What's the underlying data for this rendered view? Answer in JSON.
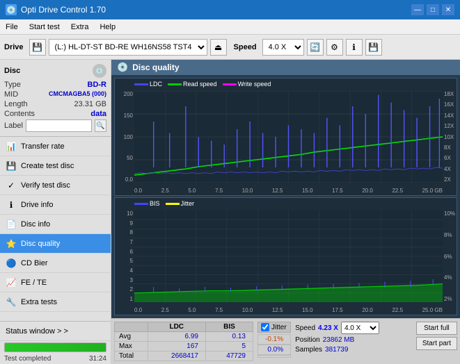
{
  "app": {
    "title": "Opti Drive Control 1.70",
    "icon": "💿"
  },
  "titlebar": {
    "title": "Opti Drive Control 1.70",
    "minimize": "—",
    "maximize": "□",
    "close": "✕"
  },
  "menubar": {
    "items": [
      "File",
      "Start test",
      "Extra",
      "Help"
    ]
  },
  "toolbar": {
    "drive_label": "Drive",
    "drive_value": "(L:) HL-DT-ST BD-RE WH16NS58 TST4",
    "speed_label": "Speed",
    "speed_value": "4.0 X"
  },
  "disc": {
    "section_label": "Disc",
    "type_key": "Type",
    "type_val": "BD-R",
    "mid_key": "MID",
    "mid_val": "CMCMAGBA5 (000)",
    "length_key": "Length",
    "length_val": "23.31 GB",
    "contents_key": "Contents",
    "contents_val": "data",
    "label_key": "Label",
    "label_placeholder": ""
  },
  "nav": {
    "items": [
      {
        "id": "transfer-rate",
        "label": "Transfer rate",
        "icon": "📊"
      },
      {
        "id": "create-test-disc",
        "label": "Create test disc",
        "icon": "💾"
      },
      {
        "id": "verify-test-disc",
        "label": "Verify test disc",
        "icon": "✓"
      },
      {
        "id": "drive-info",
        "label": "Drive info",
        "icon": "ℹ"
      },
      {
        "id": "disc-info",
        "label": "Disc info",
        "icon": "📄"
      },
      {
        "id": "disc-quality",
        "label": "Disc quality",
        "icon": "⭐",
        "active": true
      },
      {
        "id": "cd-bier",
        "label": "CD Bier",
        "icon": "🔵"
      },
      {
        "id": "fe-te",
        "label": "FE / TE",
        "icon": "📈"
      },
      {
        "id": "extra-tests",
        "label": "Extra tests",
        "icon": "🔧"
      }
    ]
  },
  "status_window": {
    "label": "Status window > >",
    "progress_pct": 100,
    "status_text": "Test completed",
    "time": "31:24"
  },
  "content": {
    "title": "Disc quality",
    "chart1": {
      "legend": [
        {
          "label": "LDC",
          "color": "#0000ff"
        },
        {
          "label": "Read speed",
          "color": "#00ff00"
        },
        {
          "label": "Write speed",
          "color": "#ff00ff"
        }
      ],
      "y_labels_left": [
        "200",
        "150",
        "100",
        "50",
        "0.0"
      ],
      "y_labels_right": [
        "18X",
        "16X",
        "14X",
        "12X",
        "10X",
        "8X",
        "6X",
        "4X",
        "2X"
      ],
      "x_labels": [
        "0.0",
        "2.5",
        "5.0",
        "7.5",
        "10.0",
        "12.5",
        "15.0",
        "17.5",
        "20.0",
        "22.5",
        "25.0 GB"
      ]
    },
    "chart2": {
      "legend": [
        {
          "label": "BIS",
          "color": "#0000ff"
        },
        {
          "label": "Jitter",
          "color": "#ffff00"
        }
      ],
      "y_labels_left": [
        "10",
        "9",
        "8",
        "7",
        "6",
        "5",
        "4",
        "3",
        "2",
        "1"
      ],
      "y_labels_right": [
        "10%",
        "8%",
        "6%",
        "4%",
        "2%"
      ],
      "x_labels": [
        "0.0",
        "2.5",
        "5.0",
        "7.5",
        "10.0",
        "12.5",
        "15.0",
        "17.5",
        "20.0",
        "22.5",
        "25.0 GB"
      ]
    }
  },
  "stats": {
    "columns": [
      "LDC",
      "BIS",
      "",
      "Jitter",
      "Speed",
      ""
    ],
    "jitter_label": "Jitter",
    "jitter_checked": true,
    "speed_current": "4.23 X",
    "speed_select": "4.0 X",
    "position_label": "Position",
    "position_val": "23862 MB",
    "samples_label": "Samples",
    "samples_val": "381739",
    "rows": [
      {
        "label": "Avg",
        "ldc": "6.99",
        "bis": "0.13",
        "jitter": "-0.1%"
      },
      {
        "label": "Max",
        "ldc": "167",
        "bis": "5",
        "jitter": "0.0%"
      },
      {
        "label": "Total",
        "ldc": "2668417",
        "bis": "47729",
        "jitter": ""
      }
    ],
    "start_full": "Start full",
    "start_part": "Start part"
  }
}
